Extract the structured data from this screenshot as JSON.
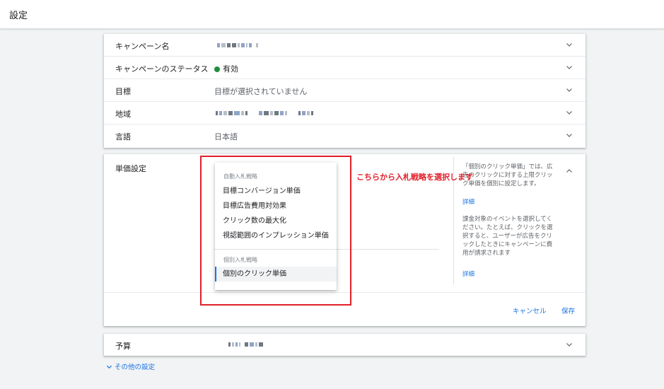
{
  "header": {
    "title": "設定"
  },
  "settings_rows": [
    {
      "label": "キャンペーン名",
      "value": ""
    },
    {
      "label": "キャンペーンのステータス",
      "value": "有効"
    },
    {
      "label": "目標",
      "value": "目標が選択されていません"
    },
    {
      "label": "地域",
      "value": ""
    },
    {
      "label": "言語",
      "value": "日本語"
    }
  ],
  "bid": {
    "label": "単価設定",
    "dropdown": {
      "group_auto": "自動入札戦略",
      "auto_items": [
        "目標コンバージョン単価",
        "目標広告費用対効果",
        "クリック数の最大化",
        "視認範囲のインプレッション単価"
      ],
      "group_manual": "個別入札戦略",
      "manual_items": [
        "個別のクリック単価"
      ],
      "selected": "個別のクリック単価"
    },
    "help": {
      "text1": "「個別のクリック単価」では、広告のクリックに対する上限クリック単価を個別に設定します。",
      "link1": "詳細",
      "text2": "課金対象のイベントを選択してください。たとえば、クリックを選択すると、ユーザーが広告をクリックしたときにキャンペーンに費用が請求されます",
      "link2": "詳細"
    },
    "cancel_label": "キャンセル",
    "save_label": "保存"
  },
  "annotation": {
    "text": "こちらから入札戦略を選択します",
    "color": "#e0202a"
  },
  "budget": {
    "label": "予算"
  },
  "more_settings": {
    "label": "その他の設定"
  },
  "colors": {
    "accent": "#1a73e8",
    "status_active": "#1e8e3e"
  }
}
